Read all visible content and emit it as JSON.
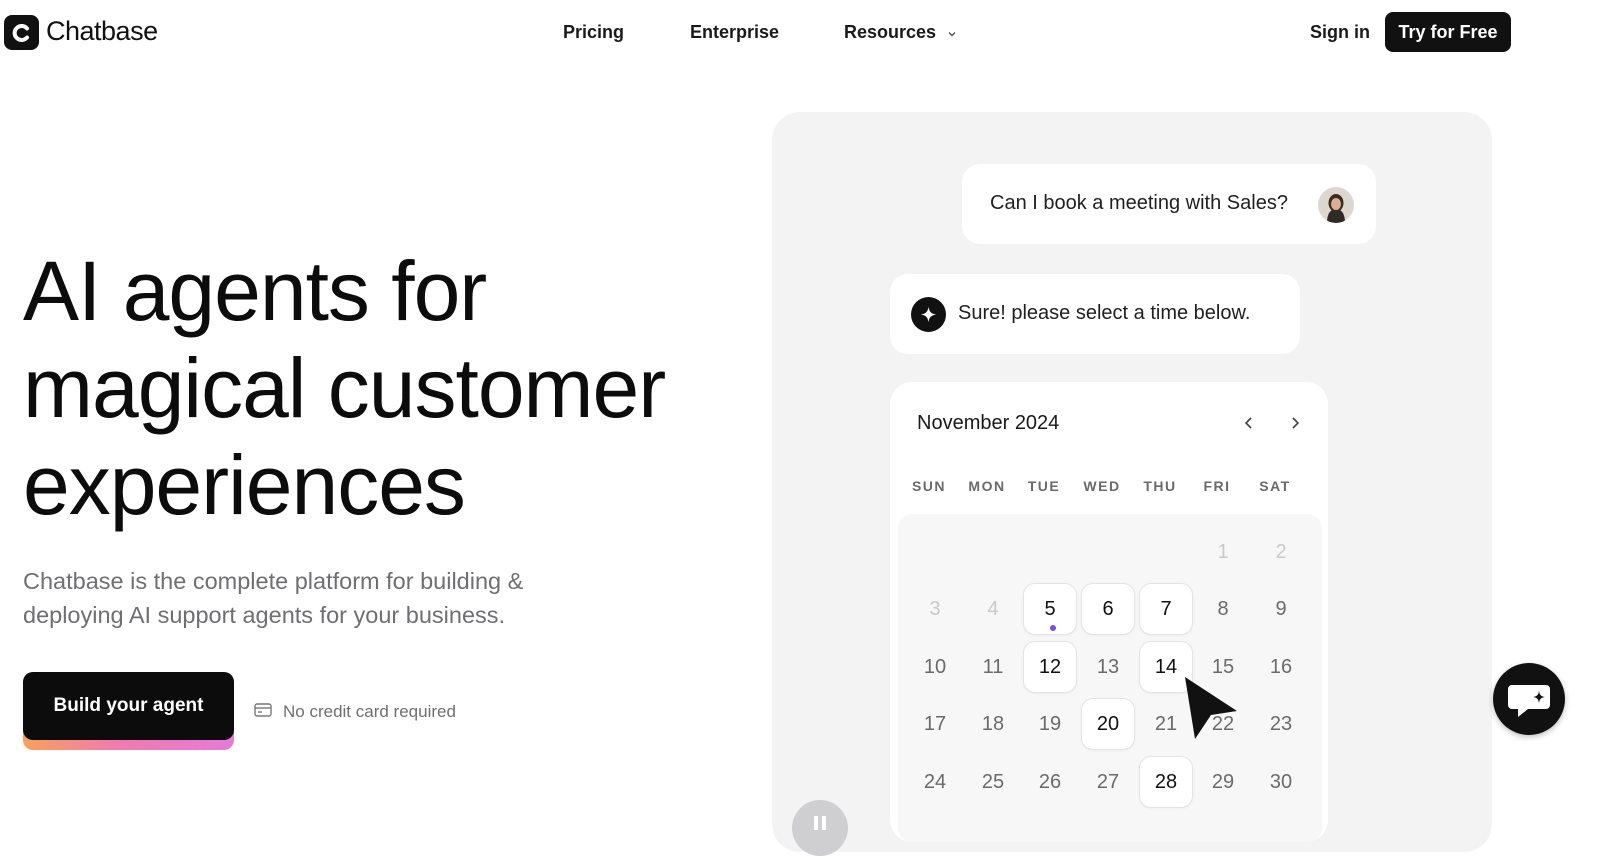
{
  "nav": {
    "brand": "Chatbase",
    "links": [
      {
        "label": "Pricing"
      },
      {
        "label": "Enterprise"
      },
      {
        "label": "Resources"
      }
    ],
    "signin": "Sign in",
    "cta": "Try for Free"
  },
  "hero": {
    "title_lines": [
      "AI agents for",
      "magical customer",
      "experiences"
    ],
    "subtitle": "Chatbase is the complete platform for building & deploying AI support agents for your business.",
    "build_button": "Build your agent",
    "no_card": "No credit card required"
  },
  "demo": {
    "user_message": "Can I book a meeting with Sales?",
    "bot_message": "Sure! please select a time below.",
    "calendar": {
      "month": "November 2024",
      "weekdays": [
        "SUN",
        "MON",
        "TUE",
        "WED",
        "THU",
        "FRI",
        "SAT"
      ],
      "weeks": [
        [
          "",
          "",
          "",
          "",
          "",
          "1",
          "2"
        ],
        [
          "3",
          "4",
          "5",
          "6",
          "7",
          "8",
          "9"
        ],
        [
          "10",
          "11",
          "12",
          "13",
          "14",
          "15",
          "16"
        ],
        [
          "17",
          "18",
          "19",
          "20",
          "21",
          "22",
          "23"
        ],
        [
          "24",
          "25",
          "26",
          "27",
          "28",
          "29",
          "30"
        ]
      ],
      "available_days": [
        "5",
        "6",
        "7",
        "12",
        "14",
        "20",
        "28"
      ],
      "past_days": [
        "1",
        "2",
        "3",
        "4"
      ],
      "marked_day": "5"
    }
  },
  "colors": {
    "primary": "#111111",
    "panel_bg": "#f3f3f4",
    "muted_text": "#6f6f72",
    "gradient": [
      "#f7a15b",
      "#f07bb0",
      "#e67ad8"
    ],
    "marker": "#7b4fd4"
  },
  "icons": [
    "chatbase-logo-icon",
    "chevron-down-icon",
    "credit-card-icon",
    "sparkle-icon",
    "chevron-left-icon",
    "chevron-right-icon",
    "cursor-arrow-icon",
    "chat-bubble-icon",
    "pause-icon"
  ]
}
